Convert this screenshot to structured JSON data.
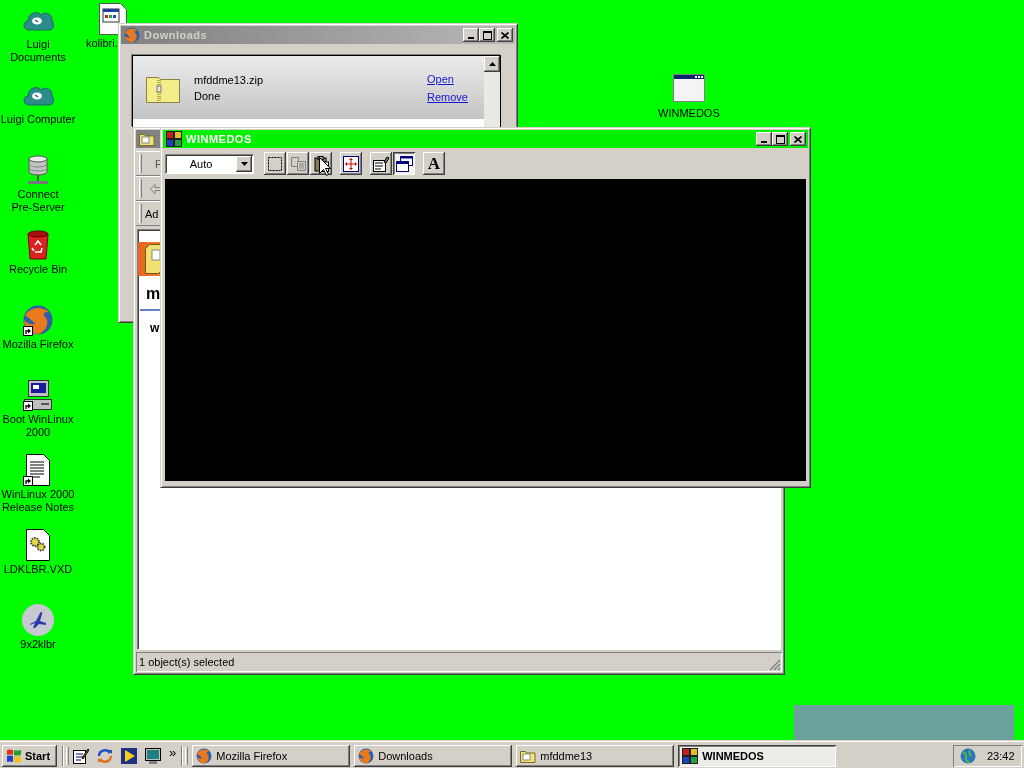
{
  "desktop_icons": [
    {
      "label": "Luigi Documents",
      "kind": "cloud",
      "shortcut": false
    },
    {
      "label": "Luigi Computer",
      "kind": "cloud",
      "shortcut": false
    },
    {
      "label": "Connect Pre-Server",
      "kind": "server",
      "shortcut": false
    },
    {
      "label": "Recycle Bin",
      "kind": "recycle_bin",
      "shortcut": false
    },
    {
      "label": "Mozilla Firefox",
      "kind": "browser",
      "shortcut": true
    },
    {
      "label": "Boot WinLinux 2000",
      "kind": "computer",
      "shortcut": true
    },
    {
      "label": "WinLinux 2000 Release Notes",
      "kind": "document",
      "shortcut": true
    },
    {
      "label": "LDKLBR.VXD",
      "kind": "gear_file",
      "shortcut": false
    },
    {
      "label": "9x2klbr",
      "kind": "airplane",
      "shortcut": false
    }
  ],
  "other_desktop_icons": [
    {
      "label": "kolibri.",
      "kind": "window_file"
    },
    {
      "label": "WINMEDOS",
      "kind": "window"
    }
  ],
  "downloads_window": {
    "title": "Downloads",
    "active": false,
    "items": [
      {
        "file": "mfddme13.zip",
        "status": "Done",
        "actions": [
          "Open",
          "Remove"
        ]
      }
    ]
  },
  "explorer_window": {
    "active": false,
    "menu_bar": [
      "F"
    ],
    "toolbar": [
      {
        "kind": "back",
        "disabled": true
      }
    ],
    "address_bar": {
      "label": "Ad"
    },
    "folder_panel": {
      "heading": "m",
      "text": "w"
    },
    "status_bar": {
      "text": "1 object(s) selected"
    }
  },
  "winmedos_window": {
    "title": "WINMEDOS",
    "active": true,
    "toolbar": {
      "font_size": "Auto",
      "button_groups": [
        {
          "buttons": [
            {
              "kind": "mark",
              "pressed": false,
              "disabled": false,
              "hovered": false
            },
            {
              "kind": "copy",
              "pressed": false,
              "disabled": true,
              "hovered": false
            },
            {
              "kind": "paste",
              "pressed": false,
              "disabled": false,
              "hovered": true
            }
          ]
        },
        {
          "buttons": [
            {
              "kind": "full_screen",
              "pressed": false,
              "disabled": false,
              "hovered": false
            }
          ]
        },
        {
          "buttons": [
            {
              "kind": "properties",
              "pressed": false,
              "disabled": false,
              "hovered": false
            },
            {
              "kind": "background",
              "pressed": true,
              "disabled": false,
              "hovered": false
            }
          ]
        },
        {
          "buttons": [
            {
              "kind": "font",
              "glyph": "A",
              "pressed": false,
              "disabled": false,
              "hovered": false
            }
          ]
        }
      ]
    }
  },
  "taskbar": {
    "start": "Start",
    "quick_launch": [
      {
        "kind": "notepad"
      },
      {
        "kind": "sync"
      },
      {
        "kind": "media"
      },
      {
        "kind": "monitor"
      }
    ],
    "more": "»",
    "tasks": [
      {
        "label": "Mozilla Firefox",
        "kind": "browser",
        "selected": false
      },
      {
        "label": "Downloads",
        "kind": "browser",
        "selected": false
      },
      {
        "label": "mfddme13",
        "kind": "folder",
        "selected": false
      },
      {
        "label": "WINMEDOS",
        "kind": "dos",
        "selected": true
      }
    ],
    "clock": "23:42"
  }
}
